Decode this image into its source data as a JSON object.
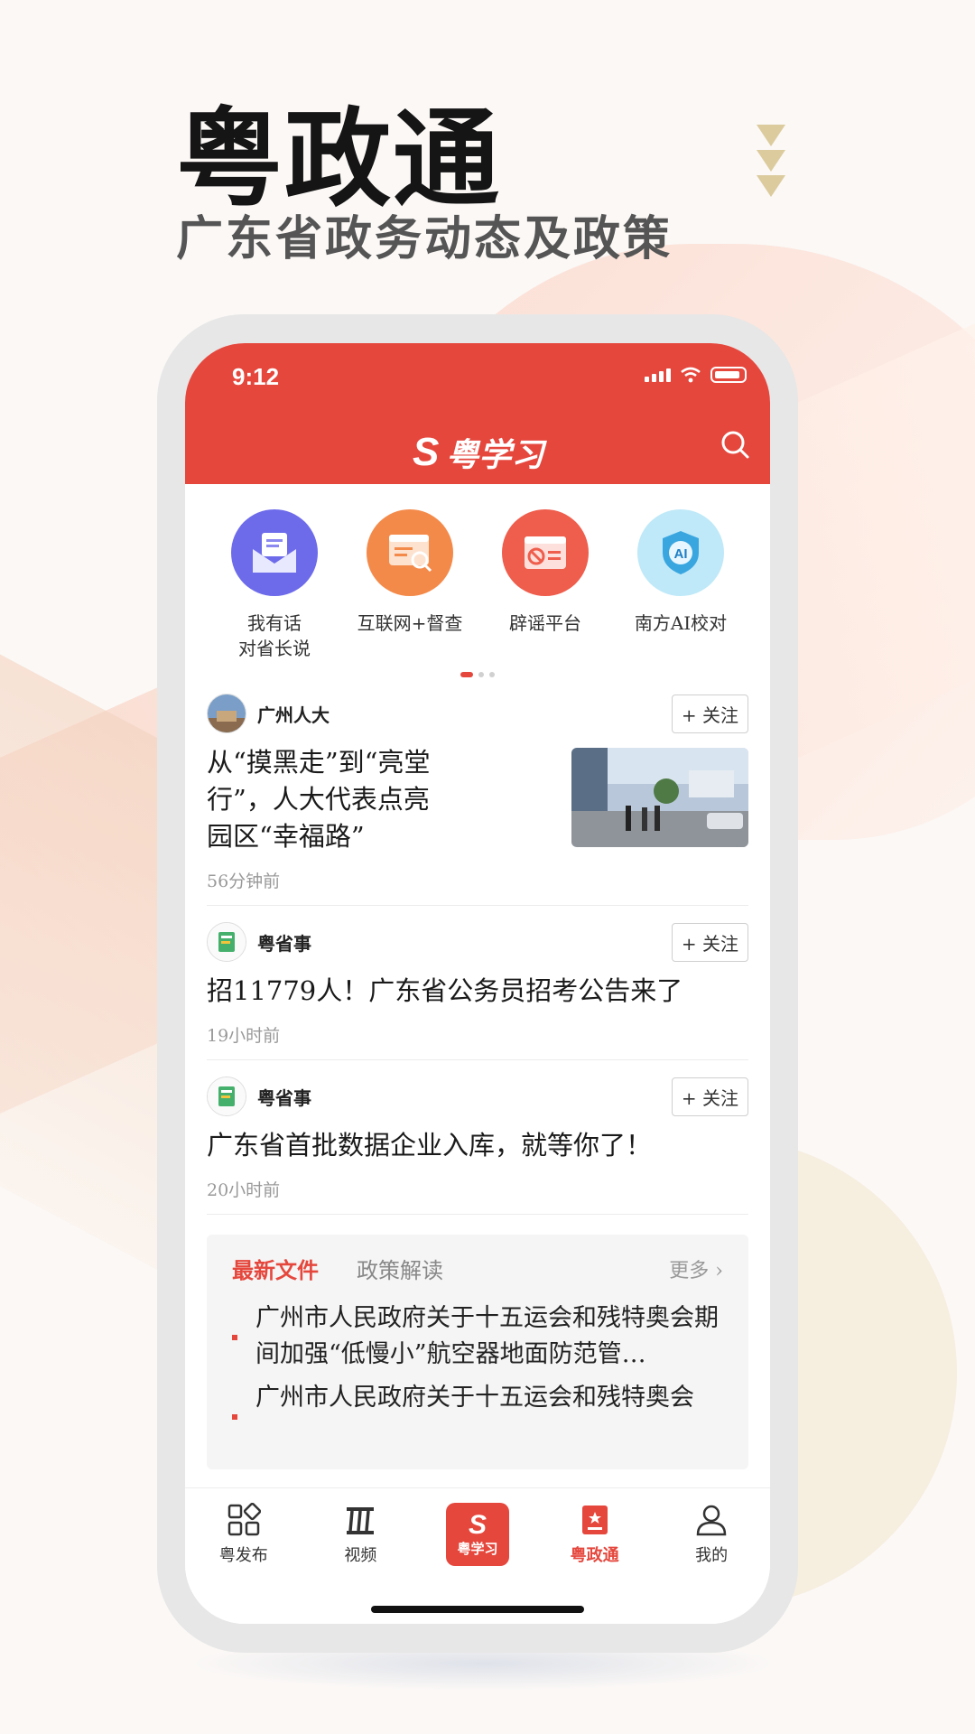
{
  "hero": {
    "title": "粤政通",
    "subtitle": "广东省政务动态及政策"
  },
  "status": {
    "time": "9:12"
  },
  "header": {
    "logo_mark": "S",
    "logo_text": "粤学习"
  },
  "shortcuts": [
    {
      "label": "我有话\n对省长说",
      "icon": "mail-icon",
      "color": "#6d6bea"
    },
    {
      "label": "互联网+督查",
      "icon": "web-search-icon",
      "color": "#f48a4a"
    },
    {
      "label": "辟谣平台",
      "icon": "rumor-block-icon",
      "color": "#ef5d4c"
    },
    {
      "label": "南方AI校对",
      "icon": "ai-shield-icon",
      "color": "#8fd3ee"
    }
  ],
  "feed": [
    {
      "source": "广州人大",
      "follow": "+ 关注",
      "title": "从“摸黑走”到“亮堂行”，人大代表点亮园区“幸福路”",
      "time": "56分钟前"
    },
    {
      "source": "粤省事",
      "follow": "+ 关注",
      "title": "招11779人！广东省公务员招考公告来了",
      "time": "19小时前"
    },
    {
      "source": "粤省事",
      "follow": "+ 关注",
      "title": "广东省首批数据企业入库，就等你了！",
      "time": "20小时前"
    }
  ],
  "docs": {
    "tab_active": "最新文件",
    "tab_other": "政策解读",
    "more": "更多 ›",
    "items": [
      "广州市人民政府关于十五运会和残特奥会期间加强“低慢小”航空器地面防范管…",
      "广州市人民政府关于十五运会和残特奥会"
    ]
  },
  "tabbar": [
    {
      "label": "粤发布",
      "icon": "grid-icon"
    },
    {
      "label": "视频",
      "icon": "video-icon"
    },
    {
      "label": "粤学习",
      "icon": "study-logo-icon"
    },
    {
      "label": "粤政通",
      "icon": "gov-badge-icon"
    },
    {
      "label": "我的",
      "icon": "user-icon"
    }
  ],
  "colors": {
    "brand": "#e5473d",
    "accent_gold": "#dccb9d"
  }
}
